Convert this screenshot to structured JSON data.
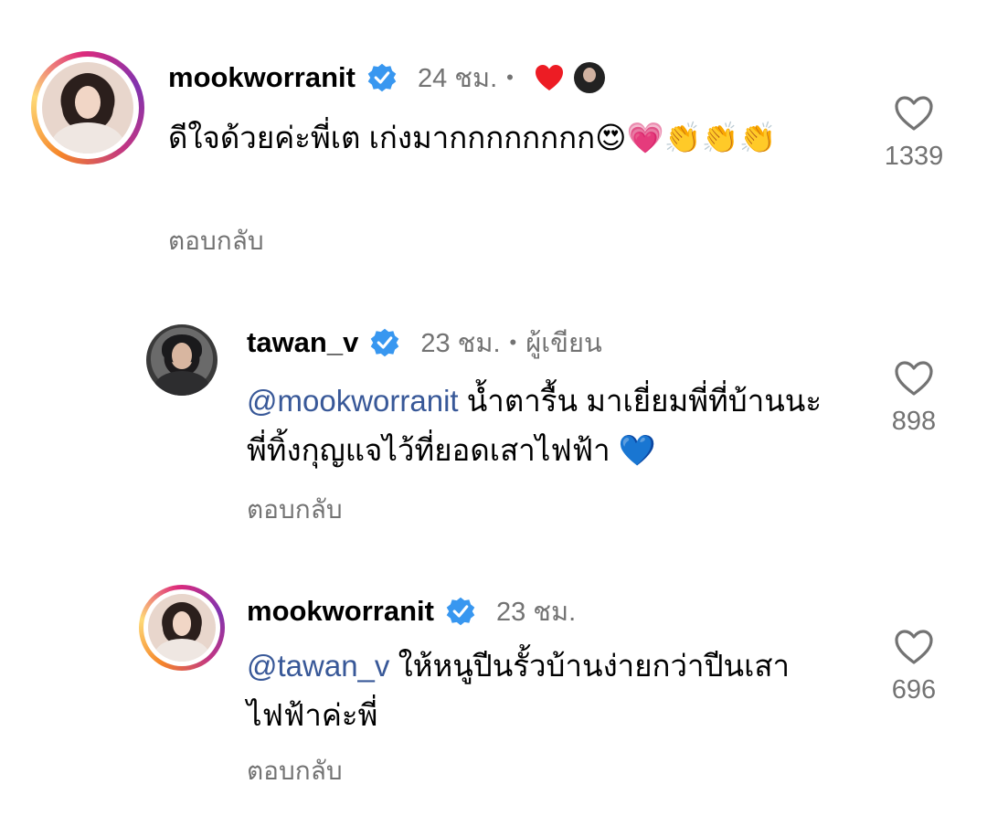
{
  "comments": [
    {
      "username": "mookworranit",
      "time": "24 ชม.",
      "dot": "•",
      "text": "ดีใจด้วยค่ะพี่เต เก่งมากกกกกกกก😍💗👏👏👏",
      "reply_label": "ตอบกลับ",
      "likes": "1339",
      "reactions": [
        "heart",
        "tawan_v avatar"
      ]
    },
    {
      "username": "tawan_v",
      "time": "23 ชม.",
      "dot": "•",
      "author_label": "ผู้เขียน",
      "mention": "@mookworranit",
      "text": " น้ำตารื้น มาเยี่ยมพี่ที่บ้านนะ พี่ทิ้งกุญแจไว้ที่ยอดเสาไฟฟ้า 💙",
      "reply_label": "ตอบกลับ",
      "likes": "898"
    },
    {
      "username": "mookworranit",
      "time": "23 ชม.",
      "mention": "@tawan_v",
      "text": " ให้หนูปีนรั้วบ้านง่ายกว่าปีนเสาไฟฟ้าค่ะพี่",
      "reply_label": "ตอบกลับ",
      "likes": "696"
    }
  ],
  "colors": {
    "verified": "#3897f0",
    "secondary_text": "#737373",
    "mention": "#385898",
    "reaction_heart": "#ed1c24"
  }
}
